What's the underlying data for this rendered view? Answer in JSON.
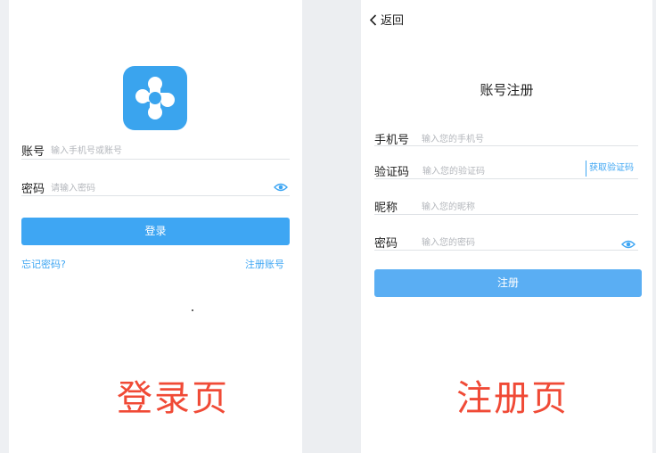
{
  "login": {
    "account_label": "账号",
    "account_placeholder": "输入手机号或账号",
    "password_label": "密码",
    "password_placeholder": "请输入密码",
    "login_button": "登录",
    "forgot_password": "忘记密码?",
    "register_link": "注册账号",
    "caption": "登录页",
    "colors": {
      "accent": "#3ea6f3",
      "logo_bg": "#3aa4ee"
    }
  },
  "register": {
    "back_label": "返回",
    "title": "账号注册",
    "phone_label": "手机号",
    "phone_placeholder": "输入您的手机号",
    "code_label": "验证码",
    "code_placeholder": "输入您的验证码",
    "get_code": "获取验证码",
    "nickname_label": "昵称",
    "nickname_placeholder": "输入您的昵称",
    "password_label": "密码",
    "password_placeholder": "输入您的密码",
    "register_button": "注册",
    "caption": "注册页",
    "colors": {
      "button": "#5aaef3",
      "caption": "#f04a36"
    }
  },
  "icons": {
    "eye": "eye-icon",
    "back": "chevron-left-icon",
    "logo": "app-logo-icon"
  }
}
